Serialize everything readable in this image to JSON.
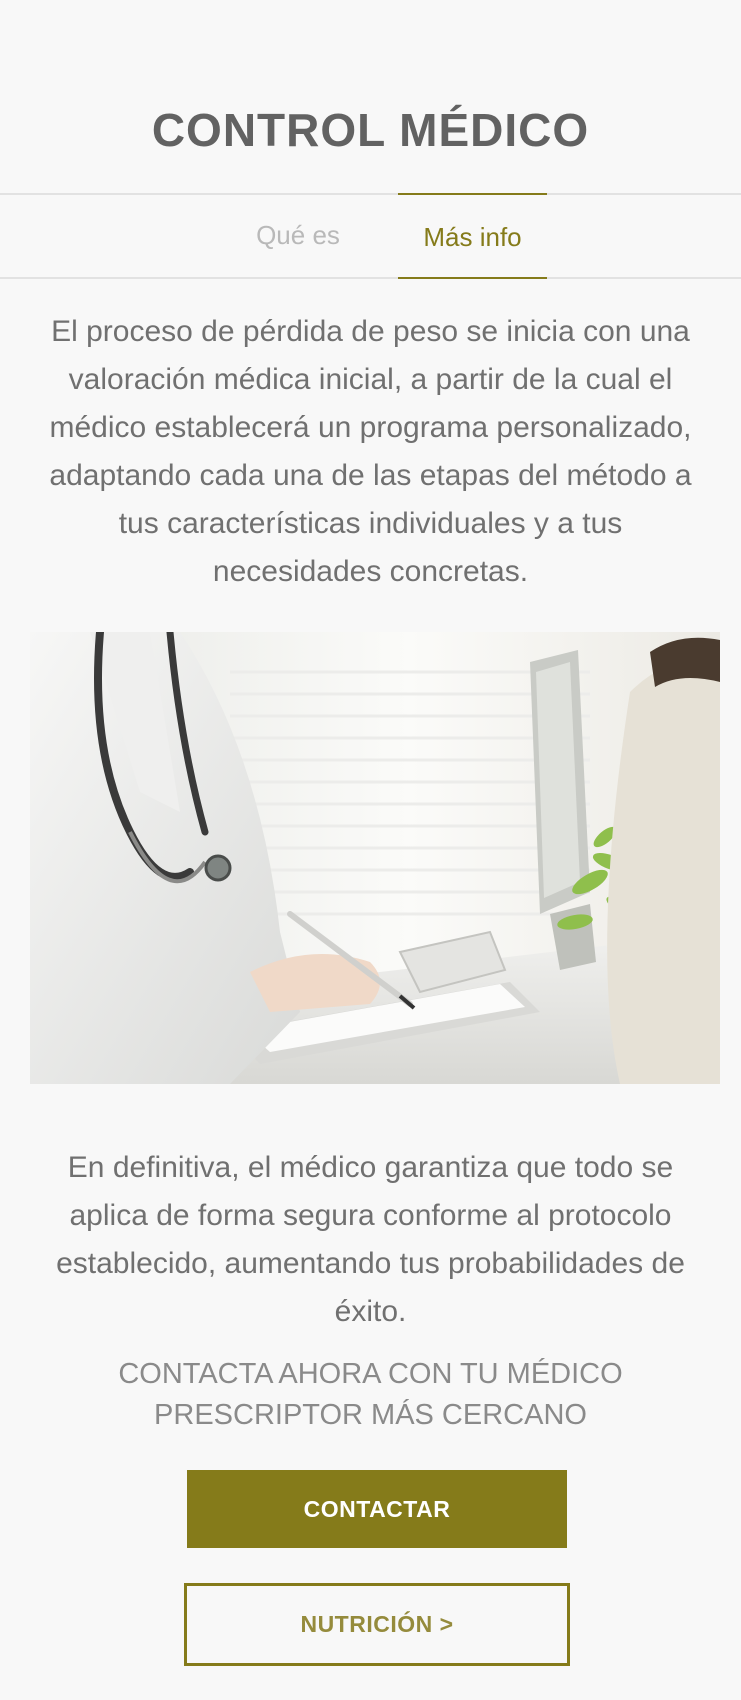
{
  "header": {
    "title": "CONTROL MÉDICO"
  },
  "tabs": [
    {
      "label": "Qué es",
      "active": false
    },
    {
      "label": "Más info",
      "active": true
    }
  ],
  "content": {
    "intro": "El proceso de pérdida de peso se inicia con una valoración médica inicial, a partir de la cual el médico establecerá un programa personalizado, adaptando cada una de las etapas del método a tus características individuales y a tus necesidades concretas.",
    "closing": "En definitiva, el médico garantiza que todo se aplica de forma segura conforme al protocolo establecido, aumentando tus probabilidades de éxito.",
    "cta_heading": "CONTACTA AHORA CON TU MÉDICO PRESCRIPTOR MÁS CERCANO"
  },
  "buttons": {
    "contact_label": "CONTACTAR",
    "nutrition_label": "NUTRICIÓN >"
  },
  "colors": {
    "accent": "#857b1a",
    "background": "#f8f8f8",
    "text": "#707070",
    "tab_inactive": "#b9b9b9"
  }
}
